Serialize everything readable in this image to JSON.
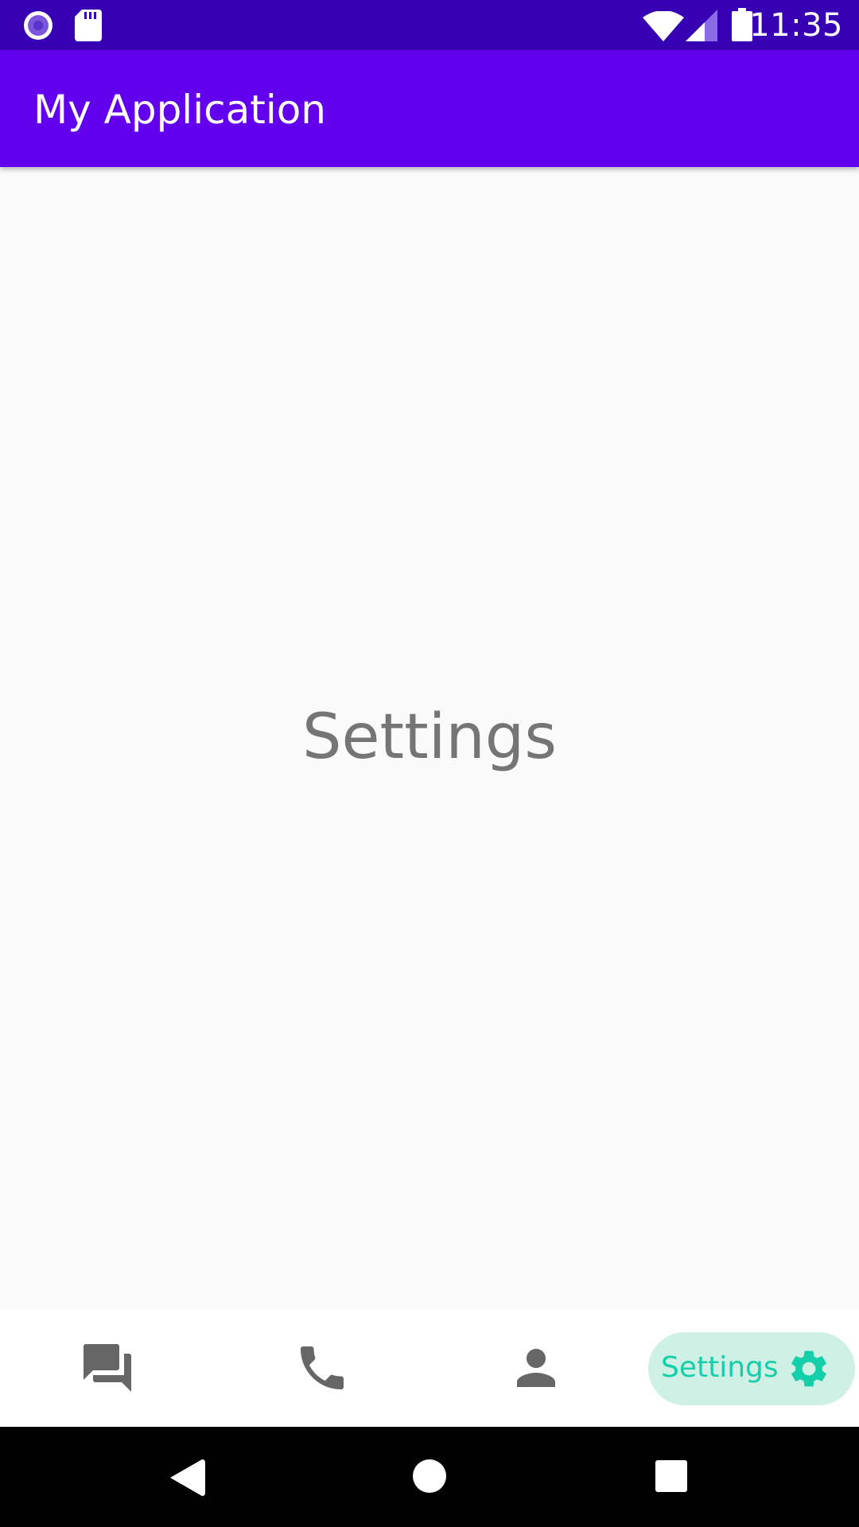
{
  "status_bar": {
    "time": "11:35",
    "left_icons": [
      "circle-notification-icon",
      "sd-card-icon"
    ],
    "right_icons": [
      "wifi-icon",
      "cellular-signal-icon",
      "battery-icon"
    ]
  },
  "app_bar": {
    "title": "My Application",
    "color": "#6200ee"
  },
  "content": {
    "label": "Settings"
  },
  "bottom_nav": {
    "items": [
      {
        "icon": "forum-icon",
        "label": ""
      },
      {
        "icon": "phone-icon",
        "label": ""
      },
      {
        "icon": "person-icon",
        "label": ""
      },
      {
        "icon": "settings-gear-icon",
        "label": "Settings",
        "selected": true
      }
    ],
    "active_color": "#14cfa9",
    "active_bg": "#cff0e4"
  },
  "system_nav": {
    "buttons": [
      "back-icon",
      "home-icon",
      "recents-icon"
    ]
  }
}
